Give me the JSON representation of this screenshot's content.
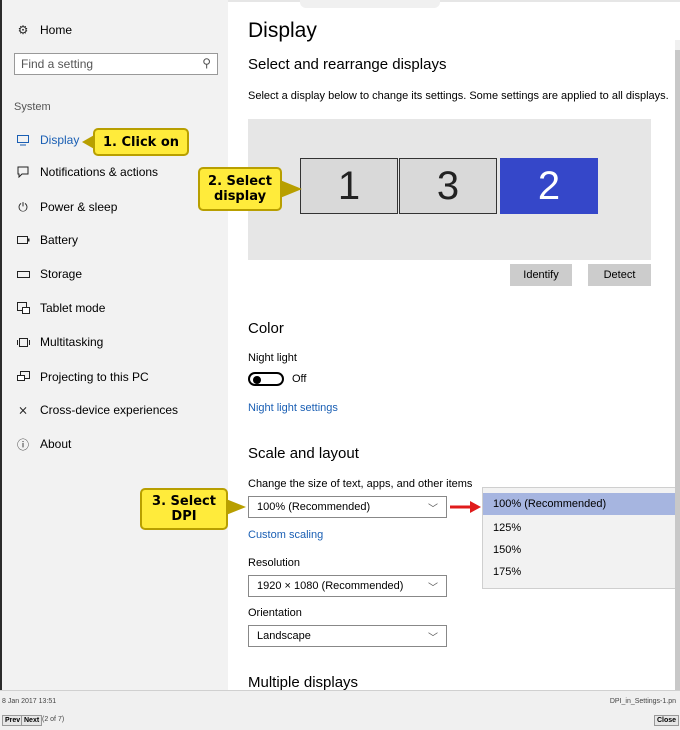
{
  "sidebar": {
    "home_label": "Home",
    "search_placeholder": "Find a setting",
    "section_label": "System",
    "items": [
      {
        "label": "Display",
        "icon": "monitor-icon"
      },
      {
        "label": "Notifications & actions",
        "icon": "notification-icon"
      },
      {
        "label": "Power & sleep",
        "icon": "power-icon"
      },
      {
        "label": "Battery",
        "icon": "battery-icon"
      },
      {
        "label": "Storage",
        "icon": "storage-icon"
      },
      {
        "label": "Tablet mode",
        "icon": "tablet-icon"
      },
      {
        "label": "Multitasking",
        "icon": "multitasking-icon"
      },
      {
        "label": "Projecting to this PC",
        "icon": "projecting-icon"
      },
      {
        "label": "Cross-device experiences",
        "icon": "cross-device-icon"
      },
      {
        "label": "About",
        "icon": "info-icon"
      }
    ]
  },
  "main": {
    "title": "Display",
    "arrange_heading": "Select and rearrange displays",
    "arrange_desc": "Select a display below to change its settings. Some settings are applied to all displays.",
    "monitors": [
      {
        "label": "1",
        "selected": false
      },
      {
        "label": "3",
        "selected": false
      },
      {
        "label": "2",
        "selected": true
      }
    ],
    "identify_label": "Identify",
    "detect_label": "Detect",
    "color_heading": "Color",
    "night_light_label": "Night light",
    "night_light_state": "Off",
    "night_light_link": "Night light settings",
    "scale_heading": "Scale and layout",
    "scale_desc": "Change the size of text, apps, and other items",
    "scale_value": "100% (Recommended)",
    "custom_scaling_link": "Custom scaling",
    "resolution_label": "Resolution",
    "resolution_value": "1920 × 1080 (Recommended)",
    "orientation_label": "Orientation",
    "orientation_value": "Landscape",
    "multiple_heading": "Multiple displays"
  },
  "dropdown": {
    "options": [
      "100% (Recommended)",
      "125%",
      "150%",
      "175%"
    ],
    "selected": "100% (Recommended)"
  },
  "callouts": {
    "step1": "1. Click on",
    "step2_line1": "2. Select",
    "step2_line2": "display",
    "step3_line1": "3. Select",
    "step3_line2": "DPI"
  },
  "colors": {
    "accent": "#1a5fb4",
    "selected_monitor": "#3547c9",
    "dropdown_selected": "#a6b5e0",
    "callout_fill": "#ffeb3b",
    "arrow_red": "#e01b1b"
  },
  "footer": {
    "date": "8 Jan 2017 13:51",
    "filename": "DPI_in_Settings-1.pn",
    "prev_label": "Prev",
    "next_label": "Next",
    "count": "(2 of 7)",
    "close_label": "Close"
  }
}
